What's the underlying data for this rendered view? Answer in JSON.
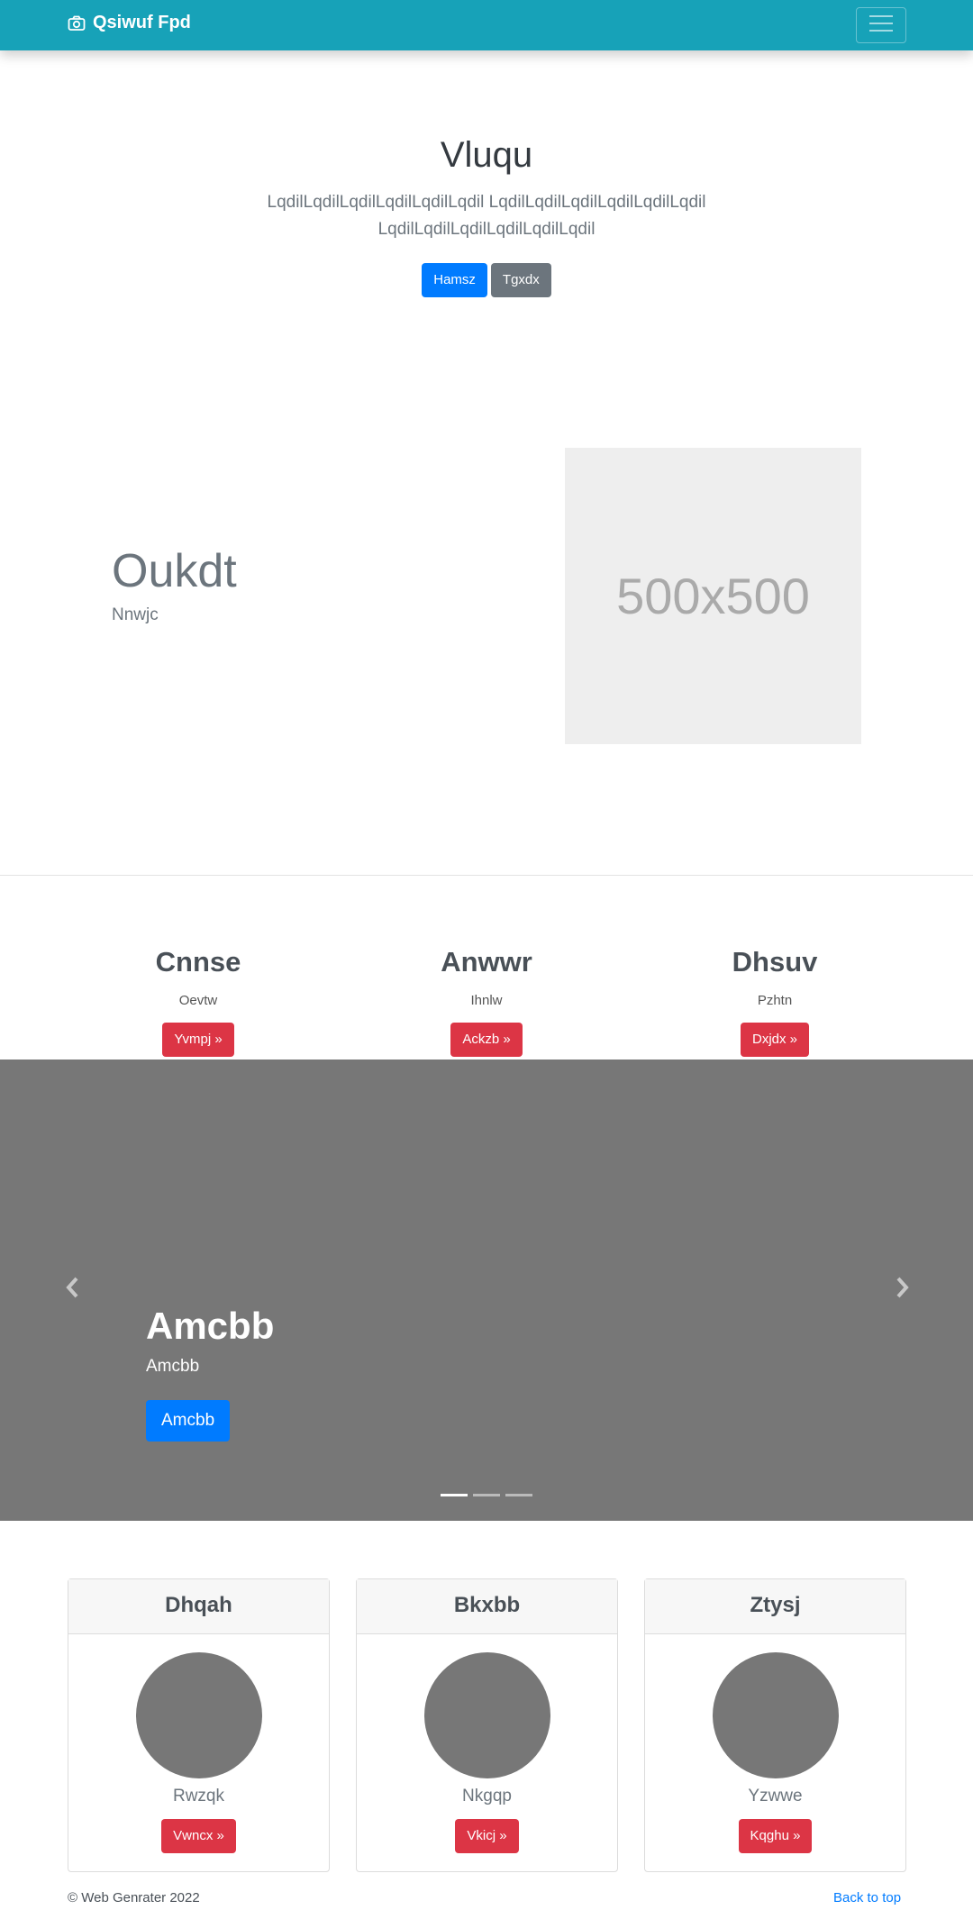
{
  "navbar": {
    "brand": "Qsiwuf Fpd",
    "icon": "camera-icon",
    "toggle_icon": "hamburger-menu-icon"
  },
  "hero": {
    "title": "Vluqu",
    "lead": "LqdilLqdilLqdilLqdilLqdilLqdil LqdilLqdilLqdilLqdilLqdilLqdil LqdilLqdilLqdilLqdilLqdilLqdil",
    "primary_button": "Hamsz",
    "secondary_button": "Tgxdx"
  },
  "feature": {
    "heading": "Oukdt",
    "subheading": "Nnwjc",
    "placeholder_text": "500x500"
  },
  "columns": [
    {
      "title": "Cnnse",
      "text": "Oevtw",
      "button": "Yvmpj »"
    },
    {
      "title": "Anwwr",
      "text": "Ihnlw",
      "button": "Ackzb »"
    },
    {
      "title": "Dhsuv",
      "text": "Pzhtn",
      "button": "Dxjdx »"
    }
  ],
  "carousel": {
    "title": "Amcbb",
    "text": "Amcbb",
    "button": "Amcbb",
    "prev_icon": "chevron-left-icon",
    "next_icon": "chevron-right-icon",
    "slide_count": 3,
    "active_slide": 1
  },
  "cards": [
    {
      "header": "Dhqah",
      "text": "Rwzqk",
      "button": "Vwncx »"
    },
    {
      "header": "Bkxbb",
      "text": "Nkgqp",
      "button": "Vkicj »"
    },
    {
      "header": "Ztysj",
      "text": "Yzwwe",
      "button": "Kqghu »"
    }
  ],
  "footer": {
    "copyright": "© Web Genrater 2022",
    "back_to_top": "Back to top"
  },
  "colors": {
    "navbar": "#17a2b8",
    "primary": "#007bff",
    "secondary": "#6c757d",
    "danger": "#dc3545",
    "carousel_bg": "#777777"
  }
}
